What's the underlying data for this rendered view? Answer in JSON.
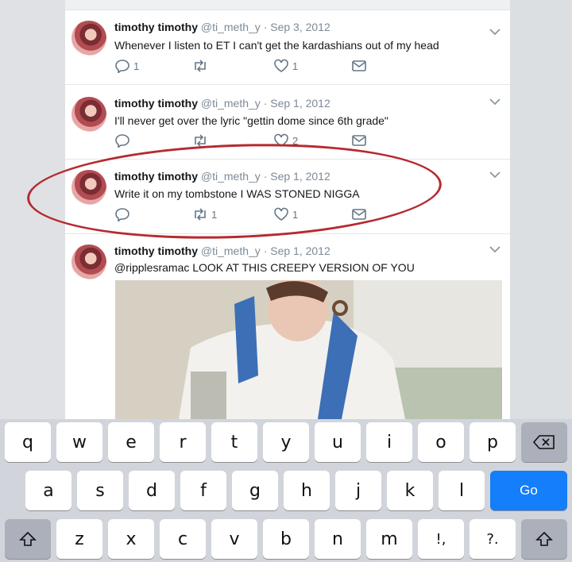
{
  "tweets": [
    {
      "name": "timothy timothy",
      "meta": "@ti_meth_y · Sep 3, 2012",
      "text": "Whenever I listen to ET I can't get the kardashians out of my head",
      "reply_count": "1",
      "retweet_count": "",
      "like_count": "1"
    },
    {
      "name": "timothy timothy",
      "meta": "@ti_meth_y · Sep 1, 2012",
      "text": "I'll never get over the lyric \"gettin dome since 6th grade\"",
      "reply_count": "",
      "retweet_count": "",
      "like_count": "2"
    },
    {
      "name": "timothy timothy",
      "meta": "@ti_meth_y · Sep 1, 2012",
      "text": "Write it on my tombstone I WAS STONED NIGGA",
      "reply_count": "",
      "retweet_count": "1",
      "like_count": "1"
    },
    {
      "name": "timothy timothy",
      "meta": "@ti_meth_y · Sep 1, 2012",
      "text": "@ripplesramac LOOK AT THIS CREEPY VERSION OF YOU"
    }
  ],
  "annotation": {
    "color": "#b52a30"
  },
  "keyboard": {
    "row1": [
      "q",
      "w",
      "e",
      "r",
      "t",
      "y",
      "u",
      "i",
      "o",
      "p"
    ],
    "row2": [
      "a",
      "s",
      "d",
      "f",
      "g",
      "h",
      "j",
      "k",
      "l"
    ],
    "row3": [
      "z",
      "x",
      "c",
      "v",
      "b",
      "n",
      "m",
      "!,",
      "?."
    ],
    "go_label": "Go",
    "icons": {
      "backspace": "backspace-icon",
      "shift": "shift-icon"
    }
  },
  "colors": {
    "accent": "#147efb",
    "icon_gray": "#657786",
    "meta_gray": "#7c8a97"
  }
}
